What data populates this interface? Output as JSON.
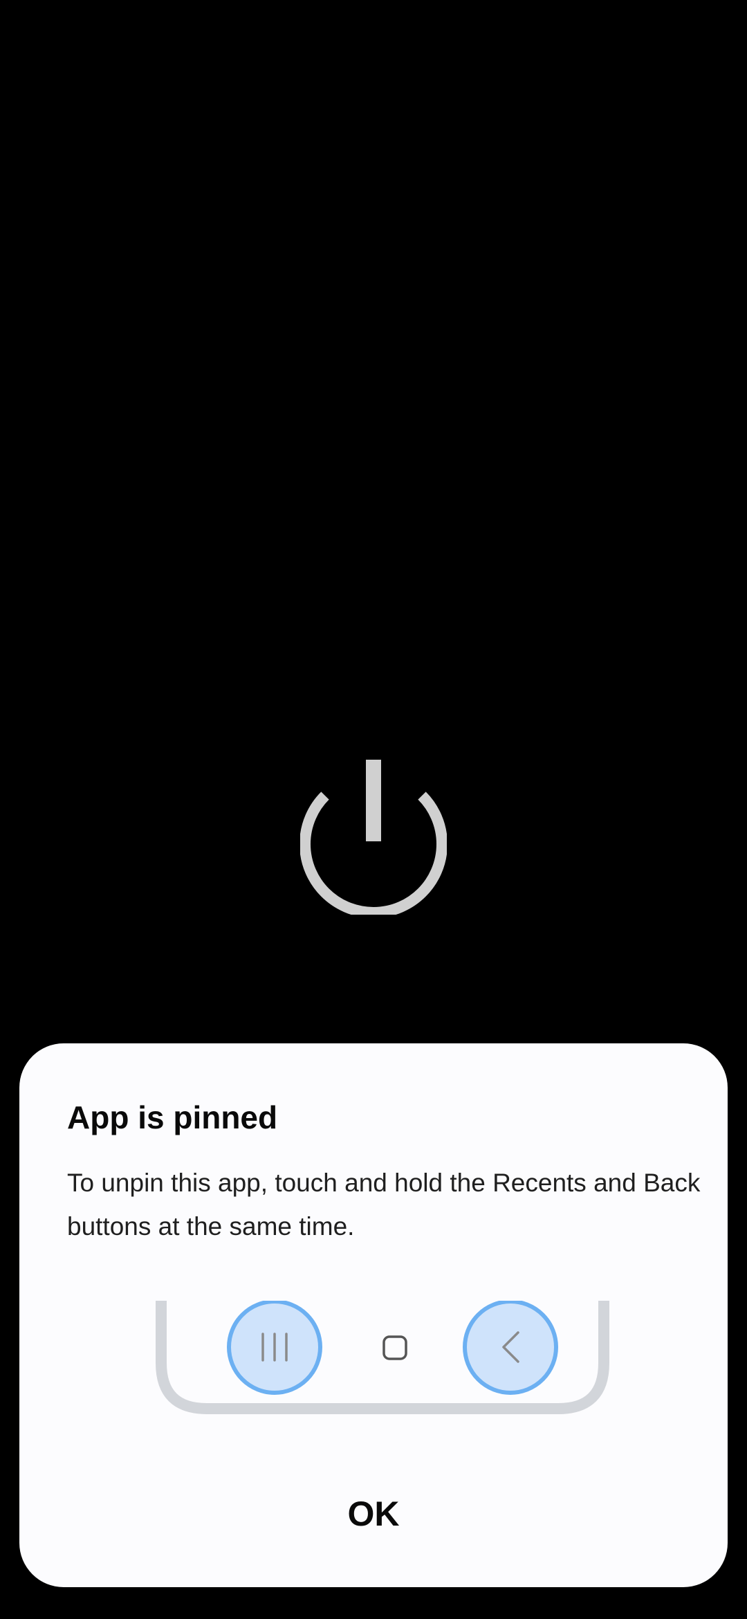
{
  "background_color": "#000000",
  "dialog": {
    "title": "App is pinned",
    "message": "To unpin this app, touch and hold the Recents and Back buttons at the same time.",
    "ok_label": "OK",
    "background_color": "#fcfcfe"
  },
  "icons": {
    "power": "power-icon",
    "recents": "recents-icon",
    "home": "home-icon",
    "back": "back-icon"
  },
  "colors": {
    "power_icon": "#d0d0d0",
    "nav_bar_outline": "#d2d5da",
    "highlight_fill": "#cfe3fb",
    "highlight_ring": "#6cb0f2",
    "nav_glyph": "#8a8a8a"
  }
}
